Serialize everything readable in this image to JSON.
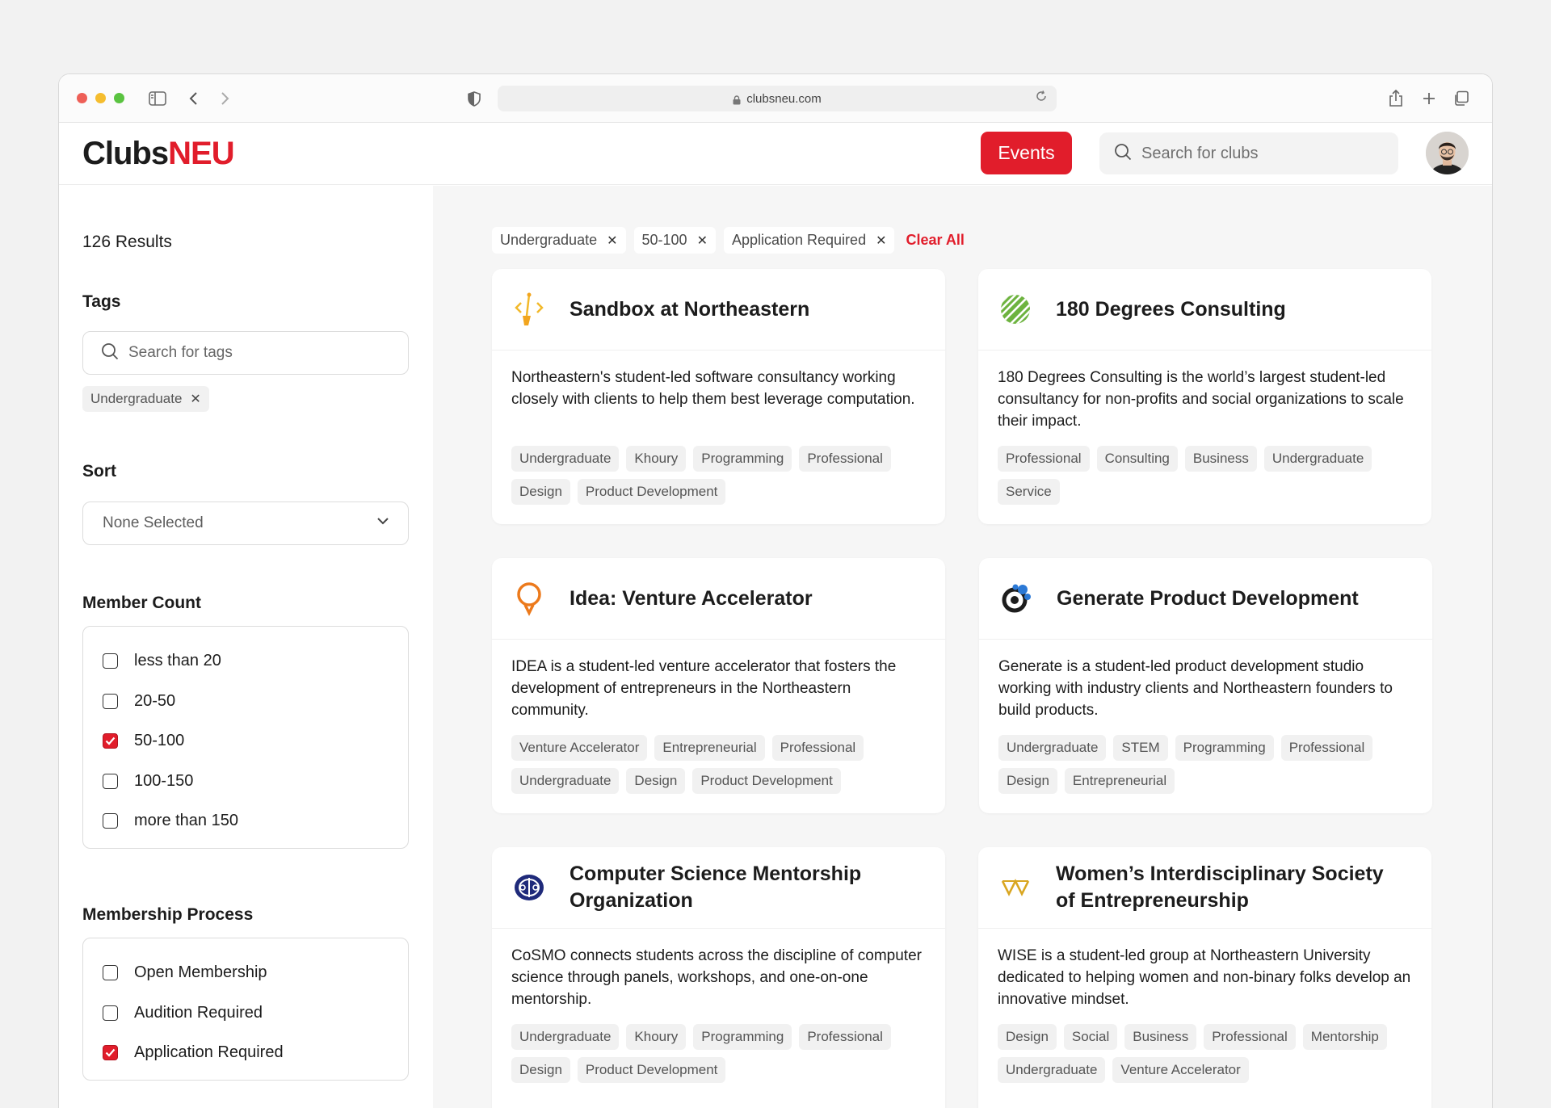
{
  "browser": {
    "url": "clubsneu.com"
  },
  "header": {
    "logo_part1": "Clubs",
    "logo_part2": "NEU",
    "events_label": "Events",
    "search_placeholder": "Search for clubs"
  },
  "sidebar": {
    "results_count": "126",
    "results_label": "Results",
    "tags_title": "Tags",
    "tag_search_placeholder": "Search for tags",
    "selected_tag": "Undergraduate",
    "sort_title": "Sort",
    "sort_value": "None Selected",
    "member_count_title": "Member Count",
    "member_count_options": [
      {
        "label": "less than 20",
        "checked": false
      },
      {
        "label": "20-50",
        "checked": false
      },
      {
        "label": "50-100",
        "checked": true
      },
      {
        "label": "100-150",
        "checked": false
      },
      {
        "label": "more than 150",
        "checked": false
      }
    ],
    "membership_title": "Membership Process",
    "membership_options": [
      {
        "label": "Open Membership",
        "checked": false
      },
      {
        "label": "Audition Required",
        "checked": false
      },
      {
        "label": "Application Required",
        "checked": true
      }
    ]
  },
  "filters": {
    "chips": [
      "Undergraduate",
      "50-100",
      "Application Required"
    ],
    "clear_label": "Clear All"
  },
  "clubs": [
    {
      "name": "Sandbox at Northeastern",
      "description": "Northeastern's student-led software consultancy working closely with clients to help them best leverage computation.",
      "tags": [
        "Undergraduate",
        "Khoury",
        "Programming",
        "Professional",
        "Design",
        "Product Development"
      ],
      "icon": "sandbox-icon"
    },
    {
      "name": "180 Degrees Consulting",
      "description": "180 Degrees Consulting is the world’s largest student-led consultancy for non-profits and social organizations to scale their impact.",
      "tags": [
        "Professional",
        "Consulting",
        "Business",
        "Undergraduate",
        "Service"
      ],
      "icon": "globe-stripes-icon"
    },
    {
      "name": "Idea: Venture Accelerator",
      "description": "IDEA is a student-led venture accelerator that fosters the development of entrepreneurs in the Northeastern community.",
      "tags": [
        "Venture Accelerator",
        "Entrepreneurial",
        "Professional",
        "Undergraduate",
        "Design",
        "Product Development"
      ],
      "icon": "lightbulb-icon"
    },
    {
      "name": "Generate Product Development",
      "description": "Generate is a student-led product development studio working with industry clients and Northeastern founders to build products.",
      "tags": [
        "Undergraduate",
        "STEM",
        "Programming",
        "Professional",
        "Design",
        "Entrepreneurial"
      ],
      "icon": "generate-gear-icon"
    },
    {
      "name": "Computer Science Mentorship Organization",
      "description": "CoSMO connects students across the discipline of computer science through panels, workshops, and one-on-one mentorship.",
      "tags": [
        "Undergraduate",
        "Khoury",
        "Programming",
        "Professional",
        "Design",
        "Product Development"
      ],
      "icon": "cosmo-icon"
    },
    {
      "name": "Women’s Interdisciplinary Society of Entrepreneurship",
      "description": "WISE is a student-led group at Northeastern University dedicated to helping women and non-binary folks develop an innovative mindset.",
      "tags": [
        "Design",
        "Social",
        "Business",
        "Professional",
        "Mentorship",
        "Undergraduate",
        "Venture Accelerator"
      ],
      "icon": "wise-w-icon"
    }
  ],
  "colors": {
    "accent": "#e11d2b",
    "page_bg": "#f6f6f6"
  }
}
